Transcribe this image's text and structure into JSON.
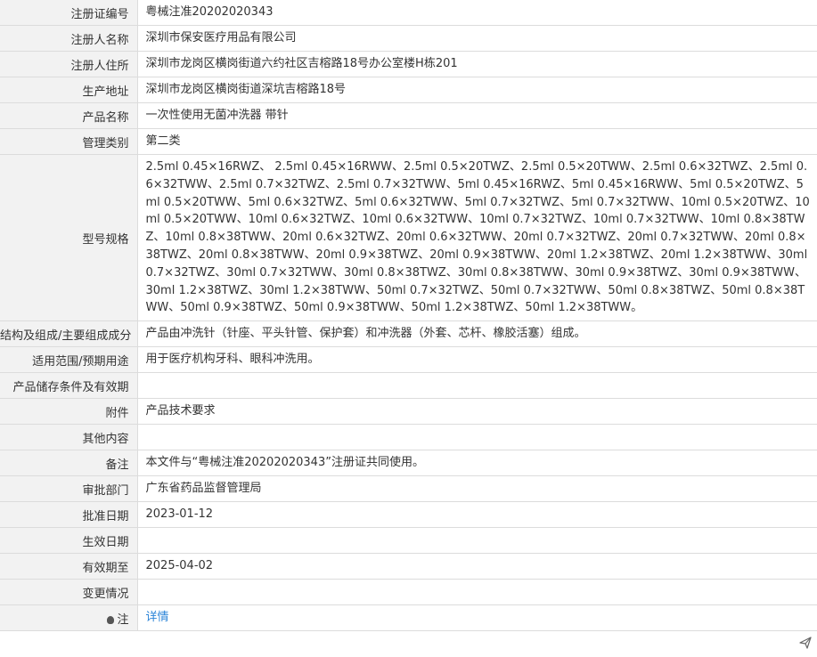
{
  "rows": [
    {
      "label": "注册证编号",
      "value": "粤械注准20202020343"
    },
    {
      "label": "注册人名称",
      "value": "深圳市保安医疗用品有限公司"
    },
    {
      "label": "注册人住所",
      "value": "深圳市龙岗区横岗街道六约社区吉榕路18号办公室楼H栋201"
    },
    {
      "label": "生产地址",
      "value": "深圳市龙岗区横岗街道深坑吉榕路18号"
    },
    {
      "label": "产品名称",
      "value": "一次性使用无菌冲洗器 带针"
    },
    {
      "label": "管理类别",
      "value": "第二类"
    },
    {
      "label": "型号规格",
      "value": "2.5ml 0.45×16RWZ、 2.5ml 0.45×16RWW、2.5ml 0.5×20TWZ、2.5ml 0.5×20TWW、2.5ml 0.6×32TWZ、2.5ml 0.6×32TWW、2.5ml 0.7×32TWZ、2.5ml 0.7×32TWW、5ml 0.45×16RWZ、5ml 0.45×16RWW、5ml 0.5×20TWZ、5ml 0.5×20TWW、5ml 0.6×32TWZ、5ml 0.6×32TWW、5ml 0.7×32TWZ、5ml 0.7×32TWW、10ml 0.5×20TWZ、10ml 0.5×20TWW、10ml 0.6×32TWZ、10ml 0.6×32TWW、10ml 0.7×32TWZ、10ml 0.7×32TWW、10ml 0.8×38TWZ、10ml 0.8×38TWW、20ml 0.6×32TWZ、20ml 0.6×32TWW、20ml 0.7×32TWZ、20ml 0.7×32TWW、20ml 0.8×38TWZ、20ml 0.8×38TWW、20ml 0.9×38TWZ、20ml 0.9×38TWW、20ml 1.2×38TWZ、20ml 1.2×38TWW、30ml 0.7×32TWZ、30ml 0.7×32TWW、30ml 0.8×38TWZ、30ml 0.8×38TWW、30ml 0.9×38TWZ、30ml 0.9×38TWW、30ml 1.2×38TWZ、30ml 1.2×38TWW、50ml 0.7×32TWZ、50ml 0.7×32TWW、50ml 0.8×38TWZ、50ml 0.8×38TWW、50ml 0.9×38TWZ、50ml 0.9×38TWW、50ml 1.2×38TWZ、50ml 1.2×38TWW。"
    },
    {
      "label": "结构及组成/主要组成成分",
      "value": "产品由冲洗针（针座、平头针管、保护套）和冲洗器（外套、芯杆、橡胶活塞）组成。"
    },
    {
      "label": "适用范围/预期用途",
      "value": "用于医疗机构牙科、眼科冲洗用。"
    },
    {
      "label": "产品储存条件及有效期",
      "value": ""
    },
    {
      "label": "附件",
      "value": "产品技术要求"
    },
    {
      "label": "其他内容",
      "value": ""
    },
    {
      "label": "备注",
      "value": "本文件与“粤械注准20202020343”注册证共同使用。"
    },
    {
      "label": "审批部门",
      "value": "广东省药品监督管理局"
    },
    {
      "label": "批准日期",
      "value": "2023-01-12"
    },
    {
      "label": "生效日期",
      "value": ""
    },
    {
      "label": "有效期至",
      "value": "2025-04-02"
    },
    {
      "label": "变更情况",
      "value": ""
    }
  ],
  "note": {
    "label": "注",
    "link": "详情",
    "icon": "bulb-icon"
  },
  "footer": {
    "icon": "send-icon"
  }
}
